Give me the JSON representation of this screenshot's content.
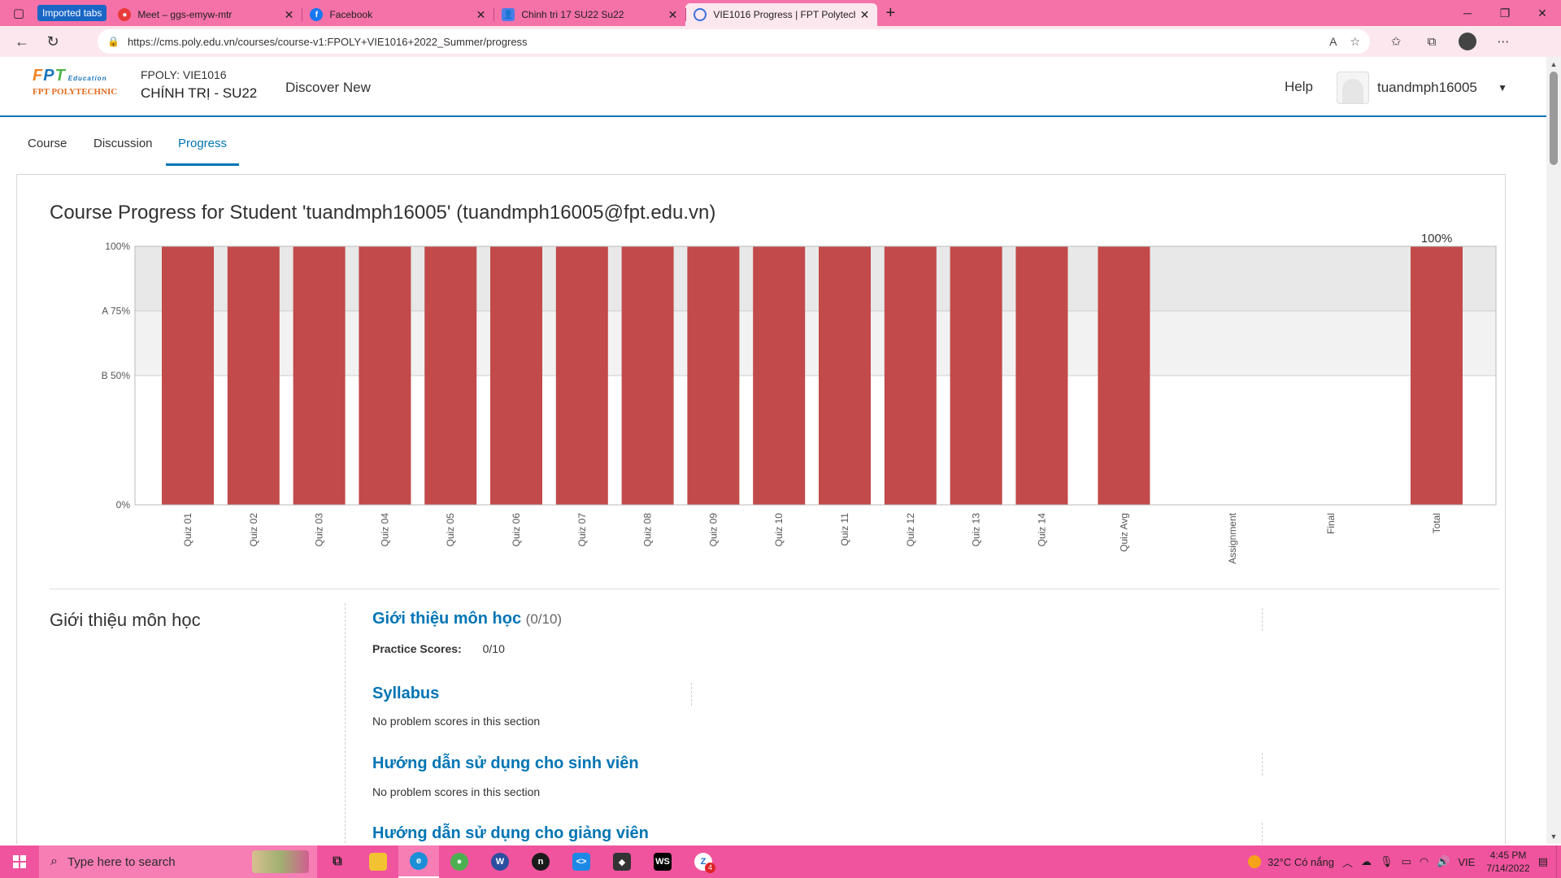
{
  "browser": {
    "tab_group_label": "Imported tabs",
    "tabs": [
      {
        "label": "Meet – ggs-emyw-mtr",
        "favicon": "meet-icon"
      },
      {
        "label": "Facebook",
        "favicon": "facebook-icon"
      },
      {
        "label": "Chinh tri 17 SU22 Su22",
        "favicon": "contacts-icon"
      },
      {
        "label": "VIE1016 Progress | FPT Polytechnic",
        "favicon": "loading-icon",
        "active": true
      }
    ],
    "url": "https://cms.poly.edu.vn/courses/course-v1:FPOLY+VIE1016+2022_Summer/progress"
  },
  "header": {
    "logo": {
      "text": "FPT",
      "sub": "Education",
      "school": "FPT POLYTECHNIC"
    },
    "course_code": "FPOLY: VIE1016",
    "course_name": "CHÍNH TRỊ - SU22",
    "discover": "Discover New",
    "help": "Help",
    "username": "tuandmph16005"
  },
  "course_tabs": [
    "Course",
    "Discussion",
    "Progress"
  ],
  "progress": {
    "title": "Course Progress for Student 'tuandmph16005' (tuandmph16005@fpt.edu.vn)"
  },
  "chart_data": {
    "type": "bar",
    "categories": [
      "Quiz 01",
      "Quiz 02",
      "Quiz 03",
      "Quiz 04",
      "Quiz 05",
      "Quiz 06",
      "Quiz 07",
      "Quiz 08",
      "Quiz 09",
      "Quiz 10",
      "Quiz 11",
      "Quiz 12",
      "Quiz 13",
      "Quiz 14",
      "Quiz Avg",
      "Assignment",
      "Final",
      "Total"
    ],
    "values": [
      100,
      100,
      100,
      100,
      100,
      100,
      100,
      100,
      100,
      100,
      100,
      100,
      100,
      100,
      100,
      0,
      0,
      100
    ],
    "ylim": [
      0,
      100
    ],
    "yticks": [
      {
        "value": 100,
        "label": "100%"
      },
      {
        "value": 75,
        "label": "A 75%"
      },
      {
        "value": 50,
        "label": "B 50%"
      },
      {
        "value": 0,
        "label": "0%"
      }
    ],
    "total_label": "100%",
    "bar_color": "#c24a4a",
    "grade_band_colors": {
      "top": "#e8e8e8",
      "a": "#f2f2f2"
    }
  },
  "chapter": {
    "title": "Giới thiệu môn học",
    "sections": [
      {
        "title": "Giới thiệu môn học",
        "score": "(0/10)",
        "practice_label": "Practice Scores:",
        "practice_value": "0/10"
      },
      {
        "title": "Syllabus",
        "note": "No problem scores in this section"
      },
      {
        "title": "Hướng dẫn sử dụng cho sinh viên",
        "note": "No problem scores in this section"
      },
      {
        "title": "Hướng dẫn sử dụng cho giảng viên"
      }
    ]
  },
  "taskbar": {
    "search_placeholder": "Type here to search",
    "weather": "32°C  Có nắng",
    "lang": "VIE",
    "time": "4:45 PM",
    "date": "7/14/2022",
    "badge": "4"
  }
}
